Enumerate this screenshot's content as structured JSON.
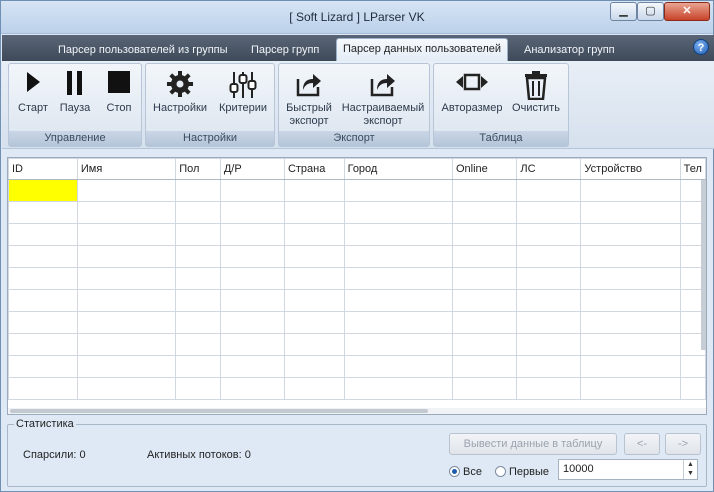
{
  "window": {
    "title": "[ Soft Lizard ] LParser VK"
  },
  "tabs": [
    {
      "label": "Парсер пользователей из группы",
      "active": false
    },
    {
      "label": "Парсер групп",
      "active": false
    },
    {
      "label": "Парсер данных пользователей",
      "active": true
    },
    {
      "label": "Анализатор групп",
      "active": false
    }
  ],
  "ribbon": {
    "groups": [
      {
        "label": "Управление",
        "buttons": [
          {
            "label": "Старт",
            "icon": "play-icon"
          },
          {
            "label": "Пауза",
            "icon": "pause-icon"
          },
          {
            "label": "Стоп",
            "icon": "stop-icon"
          }
        ]
      },
      {
        "label": "Настройки",
        "buttons": [
          {
            "label": "Настройки",
            "icon": "gear-icon"
          },
          {
            "label": "Критерии",
            "icon": "sliders-icon"
          }
        ]
      },
      {
        "label": "Экспорт",
        "buttons": [
          {
            "label": "Быстрый экспорт",
            "icon": "export-icon"
          },
          {
            "label": "Настраиваемый экспорт",
            "icon": "export-icon"
          }
        ]
      },
      {
        "label": "Таблица",
        "buttons": [
          {
            "label": "Авторазмер",
            "icon": "autosize-icon"
          },
          {
            "label": "Очистить",
            "icon": "trash-icon"
          }
        ]
      }
    ]
  },
  "table": {
    "columns": [
      "ID",
      "Имя",
      "Пол",
      "Д/Р",
      "Страна",
      "Город",
      "Online",
      "ЛС",
      "Устройство",
      "Тел"
    ],
    "row_count": 10,
    "highlight": "#ffff00"
  },
  "stats": {
    "title": "Статистика",
    "parsed_label": "Спарсили:",
    "parsed_value": "0",
    "threads_label": "Активных потоков:",
    "threads_value": "0",
    "output_button": "Вывести данные в таблицу",
    "prev_button": "<-",
    "next_button": "->",
    "radio_all": "Все",
    "radio_first": "Первые",
    "selected_radio": "all",
    "count_value": "10000"
  }
}
